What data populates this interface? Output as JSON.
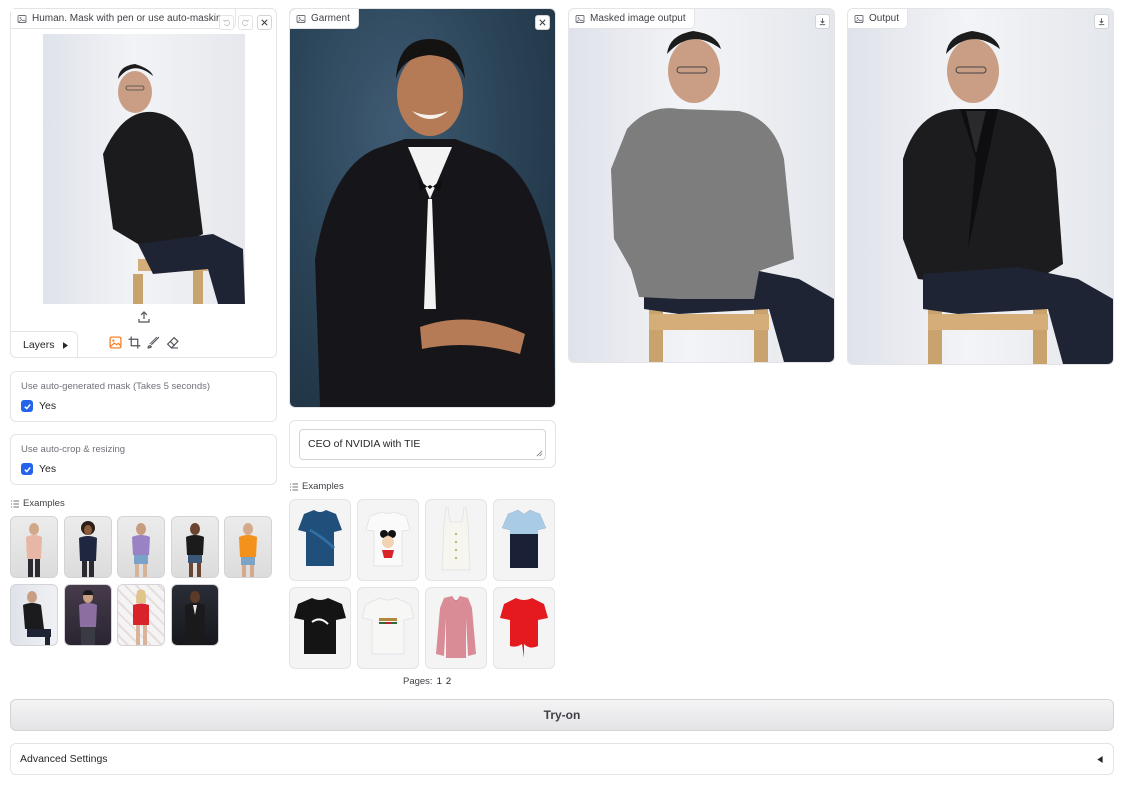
{
  "human_panel": {
    "label": "Human. Mask with pen or use auto-masking",
    "layers_label": "Layers",
    "tools": [
      "image-icon",
      "crop-icon",
      "brush-icon",
      "eraser-icon"
    ]
  },
  "garment_panel": {
    "label": "Garment",
    "description_value": "CEO of NVIDIA with TIE"
  },
  "masked_panel": {
    "label": "Masked image output"
  },
  "output_panel": {
    "label": "Output"
  },
  "auto_mask": {
    "label": "Use auto-generated mask (Takes 5 seconds)",
    "option": "Yes",
    "checked": true
  },
  "auto_crop": {
    "label": "Use auto-crop & resizing",
    "option": "Yes",
    "checked": true
  },
  "human_examples": {
    "label": "Examples",
    "count": 9
  },
  "garment_examples": {
    "label": "Examples",
    "pages_label": "Pages:",
    "pages": [
      "1",
      "2"
    ],
    "count": 8
  },
  "try_on_button": "Try-on",
  "advanced_settings": {
    "label": "Advanced Settings"
  },
  "colors": {
    "accent": "#f97316",
    "checkbox": "#2563eb",
    "border": "#e4e4e7"
  }
}
